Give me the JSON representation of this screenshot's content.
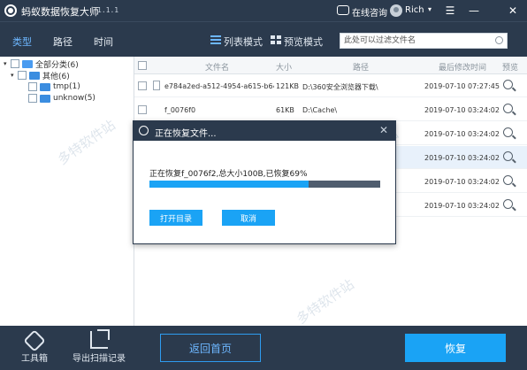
{
  "titlebar": {
    "title": "蚂蚁数据恢复大师",
    "version": "1.1.1",
    "chat_label": "在线咨询",
    "user_name": "Rich",
    "user_caret": "▾",
    "menu_glyph": "☰",
    "minimize_glyph": "—",
    "close_glyph": "✕"
  },
  "toolbar": {
    "tabs": [
      {
        "label": "类型"
      },
      {
        "label": "路径"
      },
      {
        "label": "时间"
      }
    ],
    "view_list_label": "列表模式",
    "view_preview_label": "预览模式",
    "filter_placeholder": "此处可以过滤文件名"
  },
  "tree": [
    {
      "toggle": "▾",
      "label": "全部分类(6)"
    },
    {
      "toggle": "▾",
      "label": "其他(6)"
    },
    {
      "toggle": "",
      "label": "tmp(1)"
    },
    {
      "toggle": "",
      "label": "unknow(5)"
    }
  ],
  "list": {
    "columns": [
      "文件名",
      "大小",
      "路径",
      "最后修改时间",
      "预览"
    ],
    "rows": [
      {
        "name": "e784a2ed-a512-4954-a615-b646",
        "size": "121KB",
        "path": "D:\\360安全浏览器下载\\",
        "time": "2019-07-10 07:27:45"
      },
      {
        "name": "f_0076f0",
        "size": "61KB",
        "path": "D:\\Cache\\",
        "time": "2019-07-10 03:24:02"
      },
      {
        "name": "",
        "size": "",
        "path": "",
        "time": "2019-07-10 03:24:02"
      },
      {
        "name": "",
        "size": "",
        "path": "",
        "time": "2019-07-10 03:24:02"
      },
      {
        "name": "",
        "size": "",
        "path": "",
        "time": "2019-07-10 03:24:02"
      },
      {
        "name": "",
        "size": "",
        "path": "",
        "time": "2019-07-10 03:24:02"
      }
    ]
  },
  "bottom": {
    "toolbox_label": "工具箱",
    "export_label": "导出扫描记录",
    "home_button": "返回首页",
    "recover_button": "恢复"
  },
  "dialog": {
    "title": "正在恢复文件...",
    "close_glyph": "✕",
    "status": "正在恢复f_0076f2,总大小100B,已恢复69%",
    "progress": 0.69,
    "open_dir_button": "打开目录",
    "cancel_button": "取消"
  },
  "watermark": "多特软件站",
  "colors": {
    "frame": "#2b3a4d",
    "accent": "#1aa3f5",
    "active_tab": "#6db7ff"
  }
}
